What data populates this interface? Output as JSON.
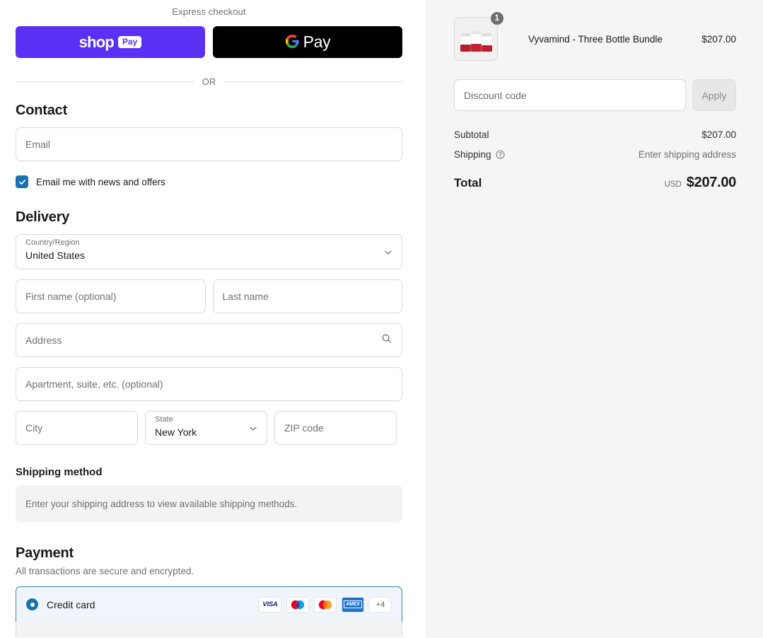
{
  "express": {
    "label": "Express checkout",
    "shop_pay": {
      "word": "shop",
      "chip": "Pay",
      "bg": "#5a31f4"
    },
    "google_pay": {
      "word": "Pay",
      "bg": "#000000"
    },
    "divider_text": "OR"
  },
  "contact": {
    "heading": "Contact",
    "email_placeholder": "Email",
    "newsletter_label": "Email me with news and offers",
    "newsletter_checked": true,
    "checkbox_color": "#1773b0"
  },
  "delivery": {
    "heading": "Delivery",
    "country": {
      "label": "Country/Region",
      "value": "United States"
    },
    "first_name_placeholder": "First name (optional)",
    "last_name_placeholder": "Last name",
    "address_placeholder": "Address",
    "apartment_placeholder": "Apartment, suite, etc. (optional)",
    "city_placeholder": "City",
    "state": {
      "label": "State",
      "value": "New York"
    },
    "zip_placeholder": "ZIP code"
  },
  "shipping_method": {
    "heading": "Shipping method",
    "notice": "Enter your shipping address to view available shipping methods."
  },
  "payment": {
    "heading": "Payment",
    "note": "All transactions are secure and encrypted.",
    "credit_card_label": "Credit card",
    "selected": true,
    "accent_color": "#1773b0",
    "brands": [
      {
        "name": "visa",
        "text": "VISA"
      },
      {
        "name": "maestro",
        "text": ""
      },
      {
        "name": "mastercard",
        "text": ""
      },
      {
        "name": "amex",
        "text": "AMEX"
      },
      {
        "name": "more",
        "text": "+4"
      }
    ]
  },
  "summary": {
    "item": {
      "name": "Vyvamind - Three Bottle Bundle",
      "price": "$207.00",
      "quantity": "1"
    },
    "discount_placeholder": "Discount code",
    "apply_label": "Apply",
    "subtotal_label": "Subtotal",
    "subtotal_value": "$207.00",
    "shipping_label": "Shipping",
    "shipping_value": "Enter shipping address",
    "total_label": "Total",
    "total_currency": "USD",
    "total_value": "$207.00"
  }
}
